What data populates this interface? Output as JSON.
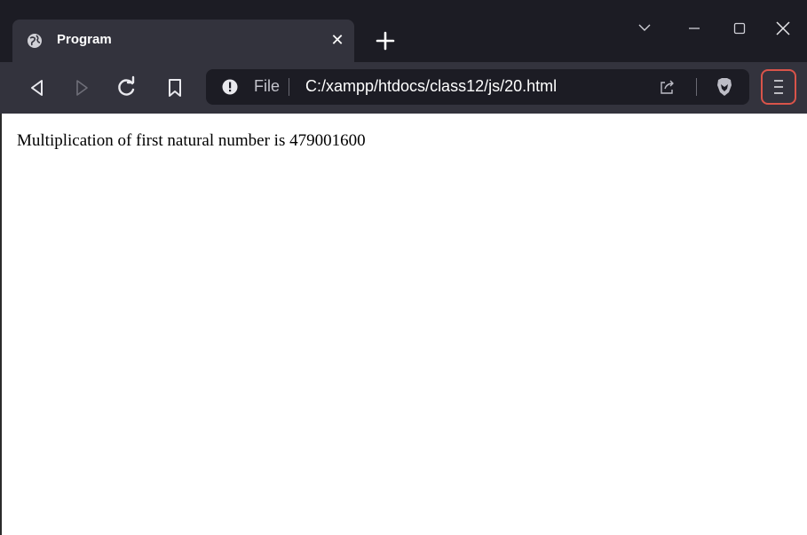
{
  "tab": {
    "title": "Program"
  },
  "address_bar": {
    "scheme_label": "File",
    "url": "C:/xampp/htdocs/class12/js/20.html"
  },
  "page": {
    "text": "Multiplication of first natural number is 479001600"
  }
}
